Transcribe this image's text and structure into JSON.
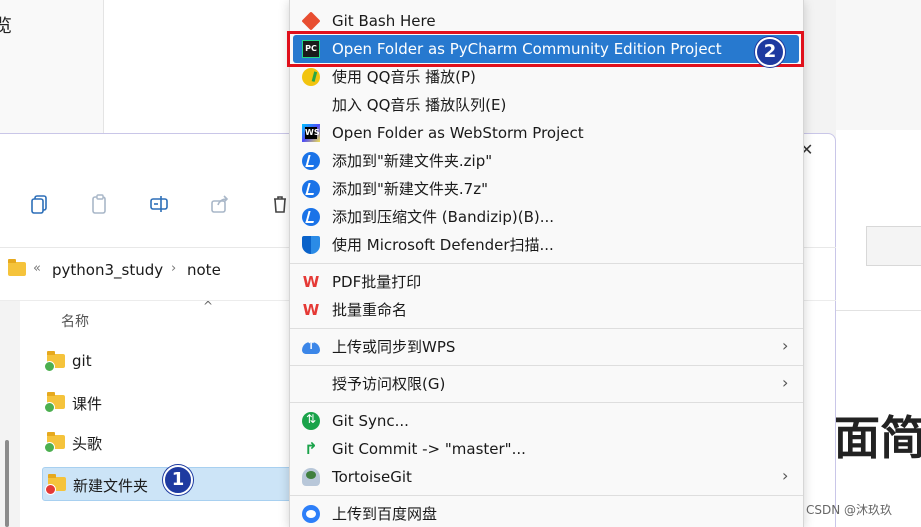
{
  "window": {
    "address": {
      "overflow": "«",
      "crumbs": [
        "python3_study",
        "note"
      ]
    },
    "columns": {
      "name": "名称"
    },
    "files": [
      {
        "name": "git",
        "status": "ok",
        "selected": false
      },
      {
        "name": "课件",
        "status": "ok",
        "selected": false
      },
      {
        "name": "头歌",
        "status": "ok",
        "selected": false
      },
      {
        "name": "新建文件夹",
        "status": "conflict",
        "selected": true
      }
    ],
    "close_glyph": "✕"
  },
  "context_menu": {
    "items": [
      {
        "label": "Git Bash Here",
        "icon": "git-icon"
      },
      {
        "label": "Open Folder as PyCharm Community Edition Project",
        "icon": "pycharm-icon",
        "highlighted": true
      },
      {
        "label": "使用 QQ音乐 播放(P)",
        "icon": "qqmusic-icon"
      },
      {
        "label": "加入 QQ音乐 播放队列(E)",
        "icon": ""
      },
      {
        "label": "Open Folder as WebStorm Project",
        "icon": "webstorm-icon"
      },
      {
        "label": "添加到\"新建文件夹.zip\"",
        "icon": "bandizip-icon"
      },
      {
        "label": "添加到\"新建文件夹.7z\"",
        "icon": "bandizip-icon"
      },
      {
        "label": "添加到压缩文件 (Bandizip)(B)...",
        "icon": "bandizip-icon"
      },
      {
        "label": "使用 Microsoft Defender扫描...",
        "icon": "defender-icon"
      },
      {
        "label": "PDF批量打印",
        "icon": "wps-icon"
      },
      {
        "label": "批量重命名",
        "icon": "wps-icon"
      },
      {
        "label": "上传或同步到WPS",
        "icon": "wps-cloud-icon",
        "submenu": true
      },
      {
        "label": "授予访问权限(G)",
        "icon": "",
        "submenu": true
      },
      {
        "label": "Git Sync...",
        "icon": "git-sync-icon"
      },
      {
        "label": "Git Commit -> \"master\"...",
        "icon": "git-commit-icon"
      },
      {
        "label": "TortoiseGit",
        "icon": "tortoisegit-icon",
        "submenu": true
      },
      {
        "label": "上传到百度网盘",
        "icon": "baidu-netdisk-icon"
      }
    ],
    "submenu_glyph": "›"
  },
  "annotations": {
    "badge_1": "1",
    "badge_2": "2"
  },
  "background": {
    "left_char": "览",
    "right_heading": "面简"
  },
  "watermark": "CSDN @沐玖玖",
  "colors": {
    "highlight": "#2779cf",
    "annotation_frame": "#e0101b",
    "badge": "#1e3aa0",
    "selection": "#cce4f7"
  }
}
